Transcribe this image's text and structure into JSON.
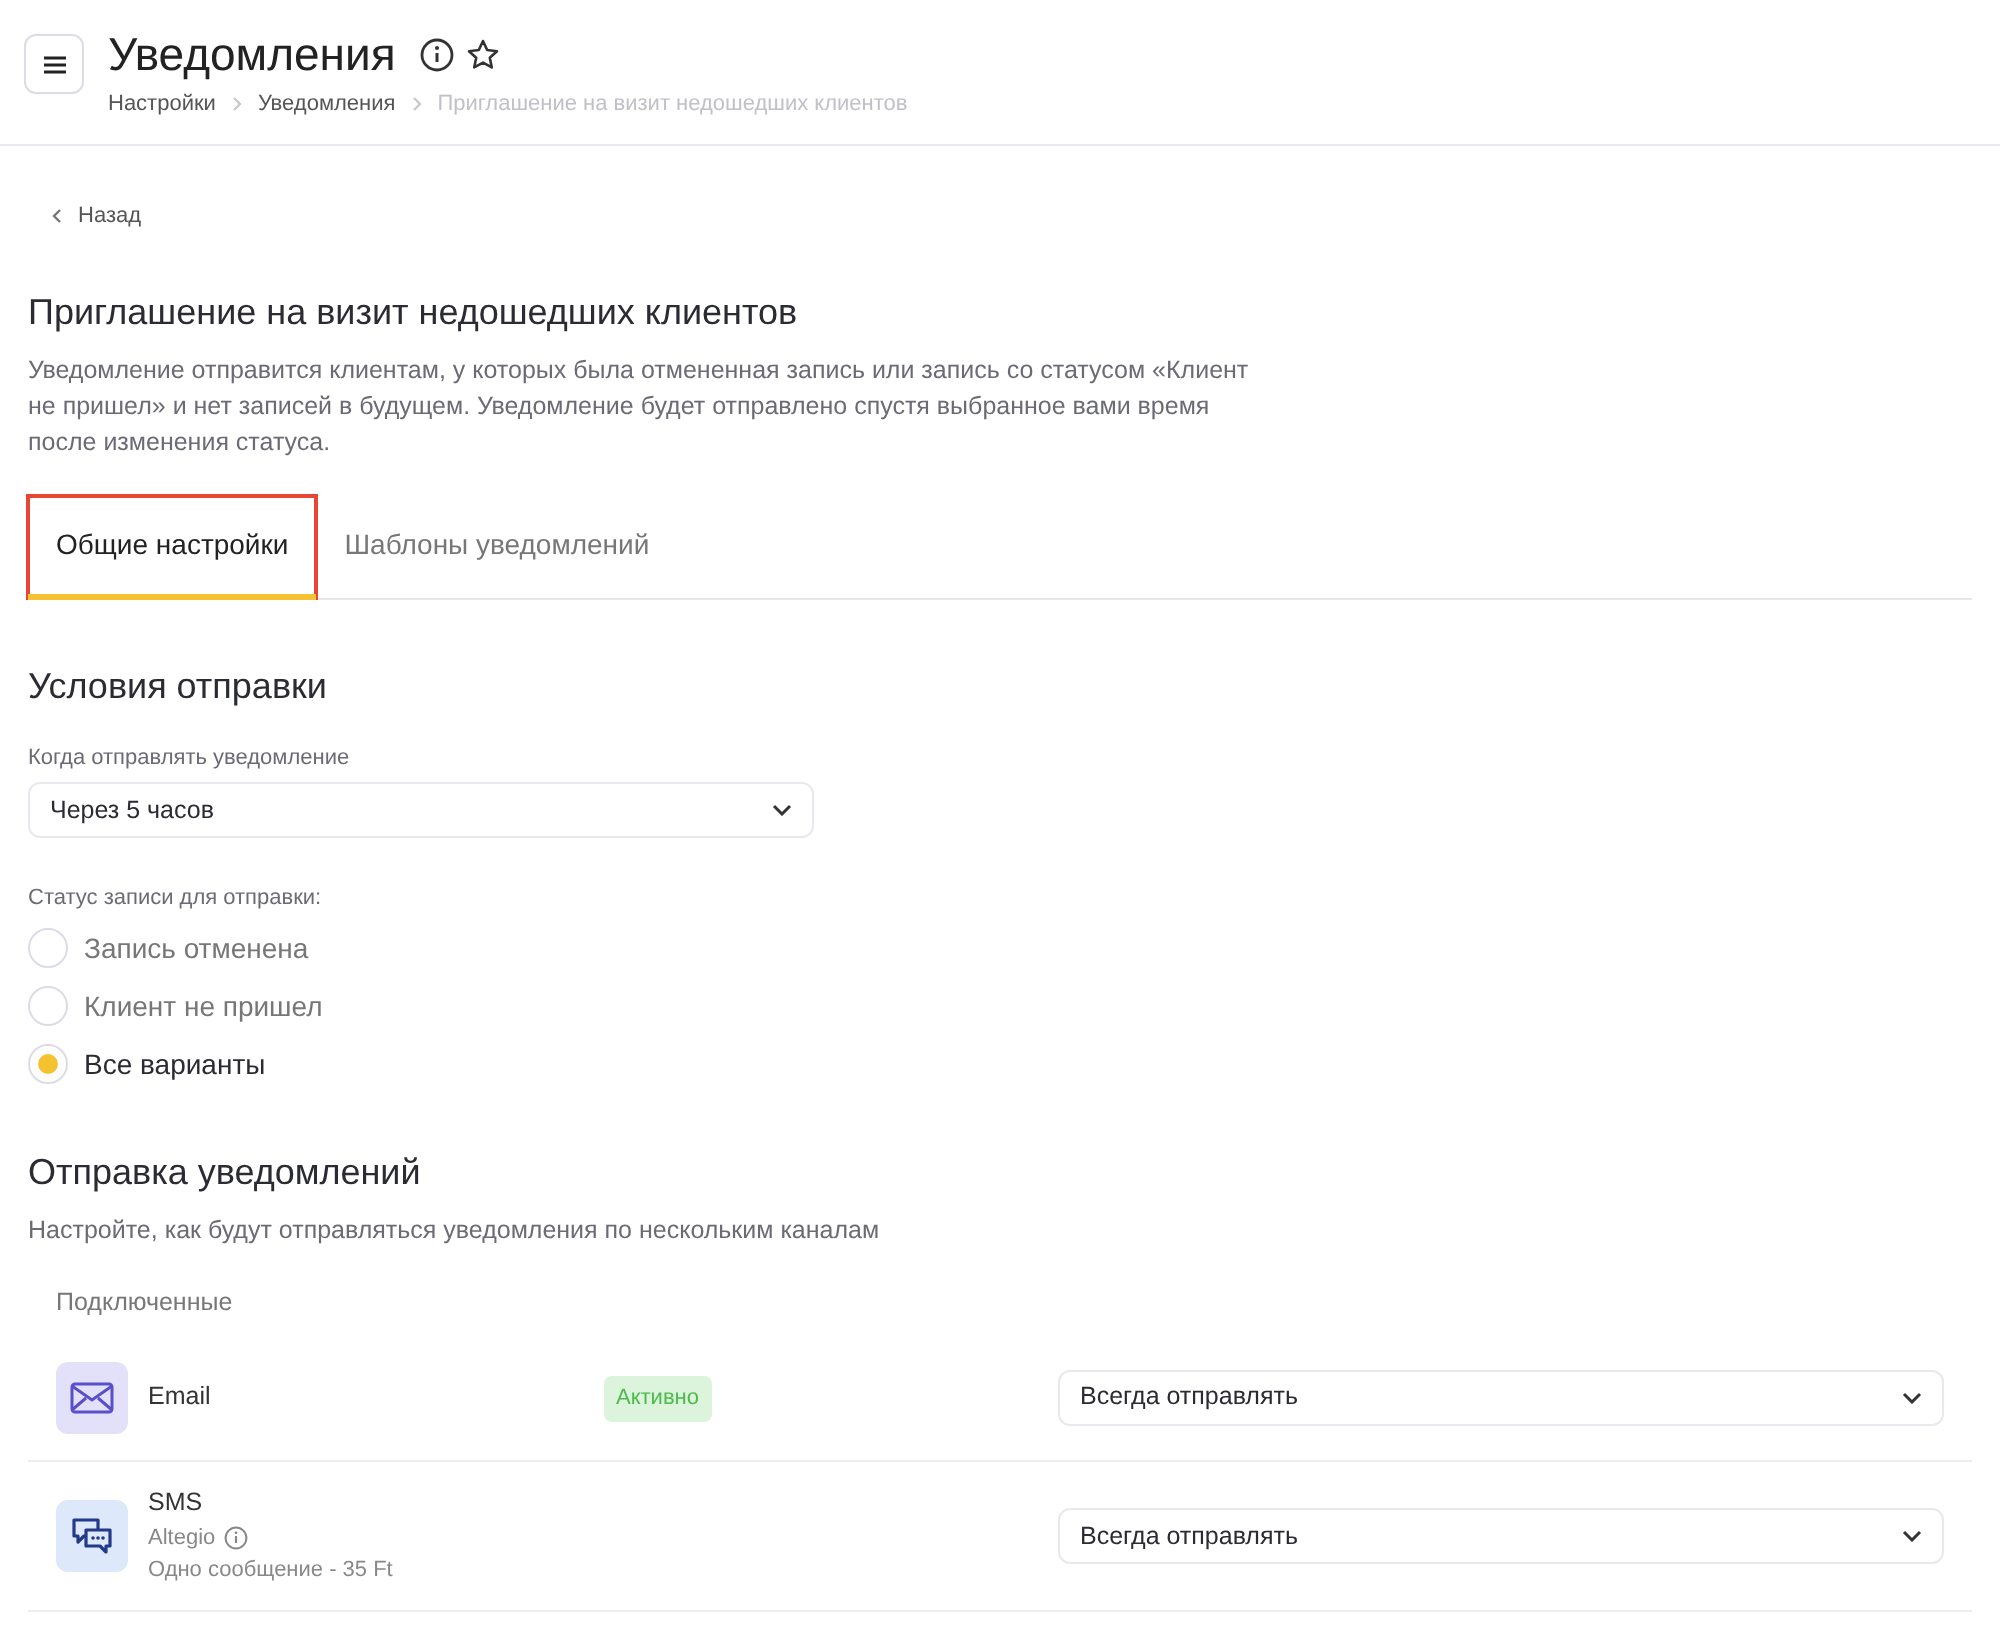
{
  "header": {
    "title": "Уведомления",
    "breadcrumbs": [
      {
        "label": "Настройки",
        "current": false
      },
      {
        "label": "Уведомления",
        "current": false
      },
      {
        "label": "Приглашение на визит недошедших клиентов",
        "current": true
      }
    ]
  },
  "back": "Назад",
  "page": {
    "title": "Приглашение на визит недошедших клиентов",
    "description": "Уведомление отправится клиентам, у которых была отмененная запись или запись со статусом «Клиент не пришел» и нет записей в будущем. Уведомление будет отправлено спустя выбранное вами время после изменения статуса."
  },
  "tabs": [
    {
      "label": "Общие настройки",
      "selected": true,
      "highlighted": true
    },
    {
      "label": "Шаблоны уведомлений",
      "selected": false,
      "highlighted": false
    }
  ],
  "conditions": {
    "title": "Условия отправки",
    "when_label": "Когда отправлять уведомление",
    "when_value": "Через 5 часов",
    "status_label": "Статус записи для отправки:",
    "options": [
      {
        "label": "Запись отменена",
        "selected": false
      },
      {
        "label": "Клиент не пришел",
        "selected": false
      },
      {
        "label": "Все варианты",
        "selected": true
      }
    ]
  },
  "sending": {
    "title": "Отправка уведомлений",
    "description": "Настройте, как будут отправляться уведомления по нескольким каналам",
    "group_label": "Подключенные",
    "channels": [
      {
        "kind": "email",
        "name": "Email",
        "badge": "Активно",
        "mode": "Всегда отправлять"
      },
      {
        "kind": "sms",
        "name": "SMS",
        "provider": "Altegio",
        "price": "Одно сообщение - 35 Ft",
        "mode": "Всегда отправлять"
      }
    ]
  }
}
